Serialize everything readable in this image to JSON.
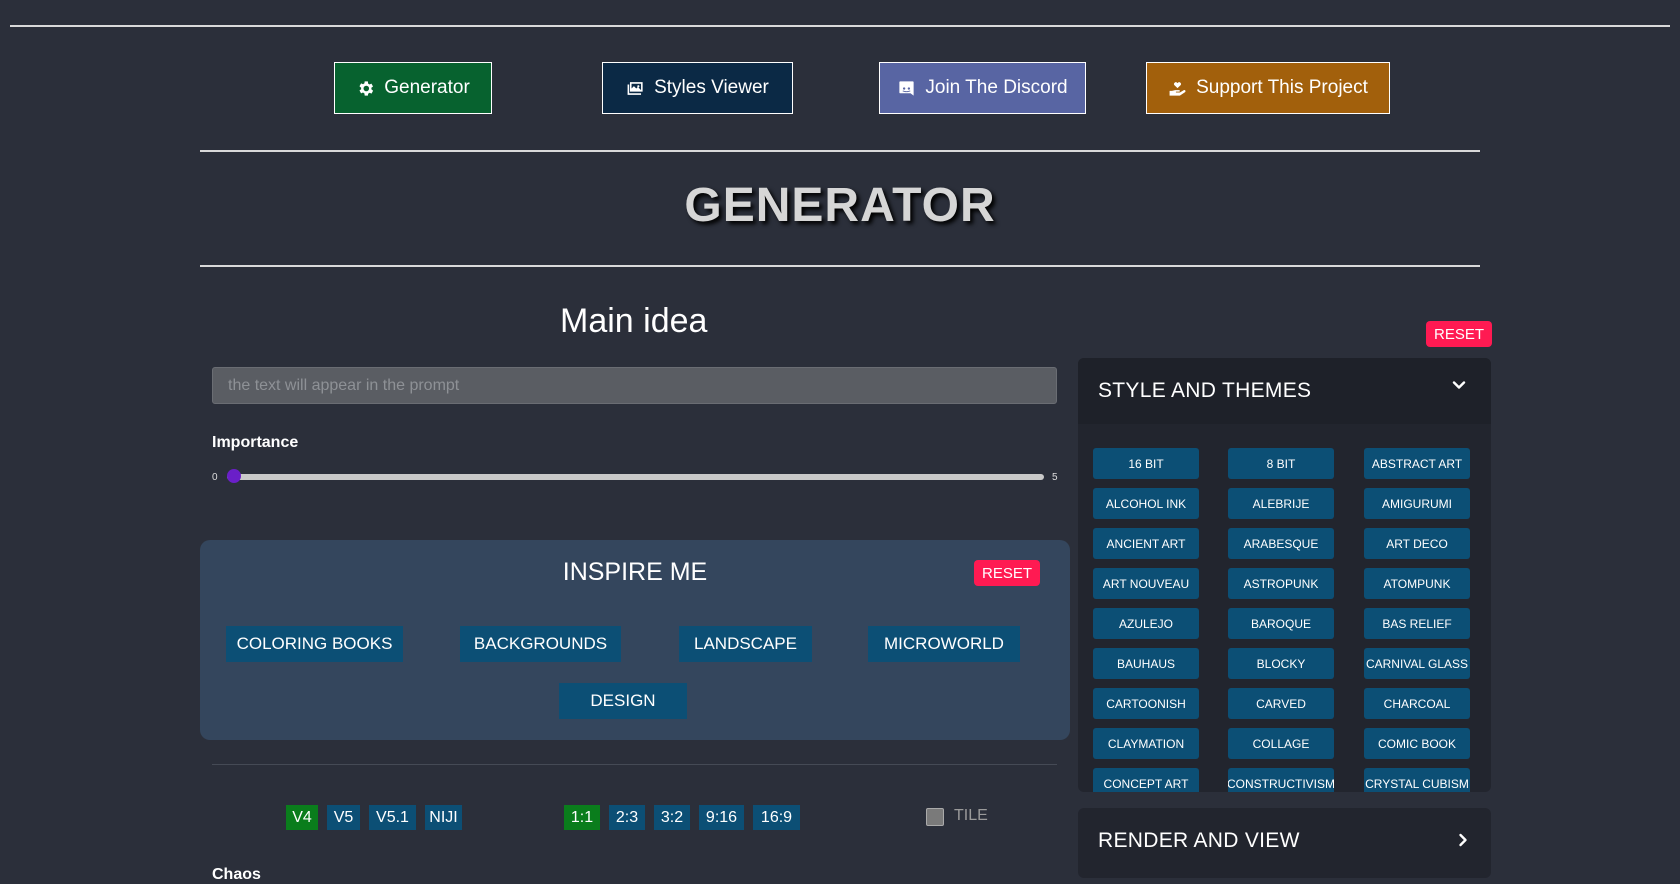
{
  "nav": {
    "generator": "Generator",
    "styles_viewer": "Styles Viewer",
    "discord": "Join The Discord",
    "support": "Support This Project"
  },
  "colors": {
    "generator_bg": "#07622f",
    "styles_viewer_bg": "#0b2945",
    "discord_bg": "#5865a3",
    "support_bg": "#a2600c",
    "reset": "#ff1a52",
    "button_blue": "#0c4f75",
    "active_green": "#0a7d1c",
    "slider_thumb": "#6a1fc8"
  },
  "page_title": "GENERATOR",
  "main_idea": {
    "title": "Main idea",
    "prompt_placeholder": "the text will appear in the prompt",
    "prompt_value": "",
    "importance_label": "Importance",
    "importance_min": "0",
    "importance_max": "5",
    "importance_value": 0
  },
  "reset_label": "RESET",
  "inspire": {
    "title": "INSPIRE ME",
    "reset": "RESET",
    "buttons": [
      "COLORING BOOKS",
      "BACKGROUNDS",
      "LANDSCAPE",
      "MICROWORLD",
      "DESIGN"
    ]
  },
  "options": {
    "versions": [
      "V4",
      "V5",
      "V5.1",
      "NIJI"
    ],
    "active_version": "V4",
    "ratios": [
      "1:1",
      "2:3",
      "3:2",
      "9:16",
      "16:9"
    ],
    "active_ratio": "1:1",
    "tile_label": "TILE",
    "tile_checked": false,
    "chaos_label": "Chaos"
  },
  "styles_panel": {
    "title": "STYLE AND THEMES",
    "expanded": true,
    "chevron_icon": "chevron-down-icon",
    "items": [
      "16 BIT",
      "8 BIT",
      "ABSTRACT ART",
      "ALCOHOL INK",
      "ALEBRIJE",
      "AMIGURUMI",
      "ANCIENT ART",
      "ARABESQUE",
      "ART DECO",
      "ART NOUVEAU",
      "ASTROPUNK",
      "ATOMPUNK",
      "AZULEJO",
      "BAROQUE",
      "BAS RELIEF",
      "BAUHAUS",
      "BLOCKY",
      "CARNIVAL GLASS",
      "CARTOONISH",
      "CARVED",
      "CHARCOAL",
      "CLAYMATION",
      "COLLAGE",
      "COMIC BOOK",
      "CONCEPT ART",
      "CONSTRUCTIVISM",
      "CRYSTAL CUBISM"
    ]
  },
  "render_panel": {
    "title": "RENDER AND VIEW",
    "expanded": false,
    "chevron_icon": "chevron-right-icon"
  }
}
